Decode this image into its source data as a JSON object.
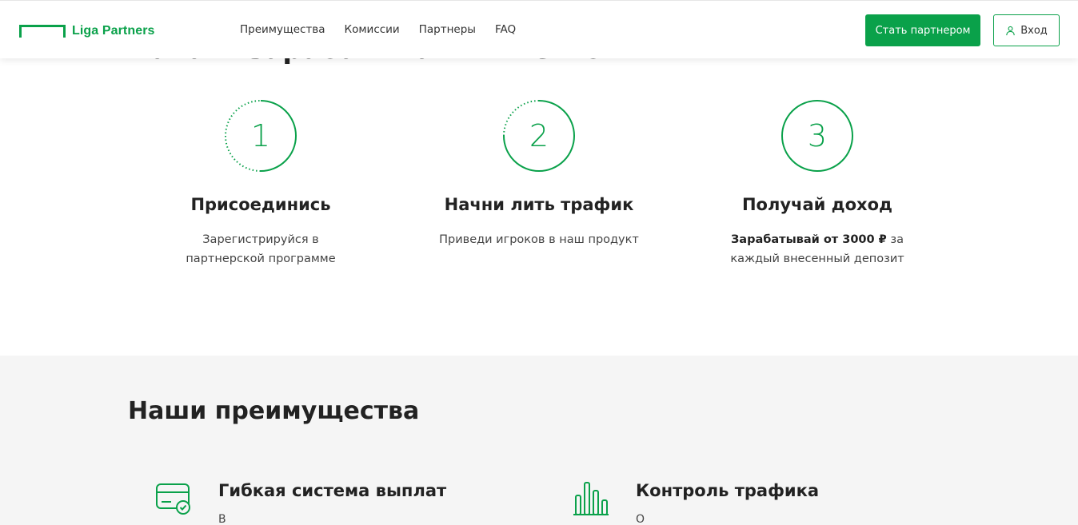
{
  "header": {
    "logo_text": "Liga Partners",
    "nav": [
      "Преимущества",
      "Комиссии",
      "Партнеры",
      "FAQ"
    ],
    "become_partner_label": "Стать партнером",
    "login_label": "Вход"
  },
  "intro": {
    "heading": "Начать зарабатывать — легко"
  },
  "steps": [
    {
      "number": "1",
      "title": "Присоединись",
      "desc_line1": "Зарегистрируйся в",
      "desc_line2": "партнерской программе"
    },
    {
      "number": "2",
      "title": "Начни лить трафик",
      "desc_line1": "Приведи игроков в наш продукт",
      "desc_line2": ""
    },
    {
      "number": "3",
      "title": "Получай доход",
      "desc_bold": "Зарабатывай от 3000 ₽",
      "desc_rest": " за",
      "desc_line2": "каждый внесенный депозит"
    }
  ],
  "advantages": {
    "title": "Наши преимущества",
    "items": [
      {
        "icon": "card-check-icon",
        "title": "Гибкая система выплат",
        "desc": "В"
      },
      {
        "icon": "bar-chart-icon",
        "title": "Контроль трафика",
        "desc": "О"
      }
    ]
  },
  "colors": {
    "brand_green": "#0aa14a",
    "section_bg": "#f5f5f5"
  }
}
